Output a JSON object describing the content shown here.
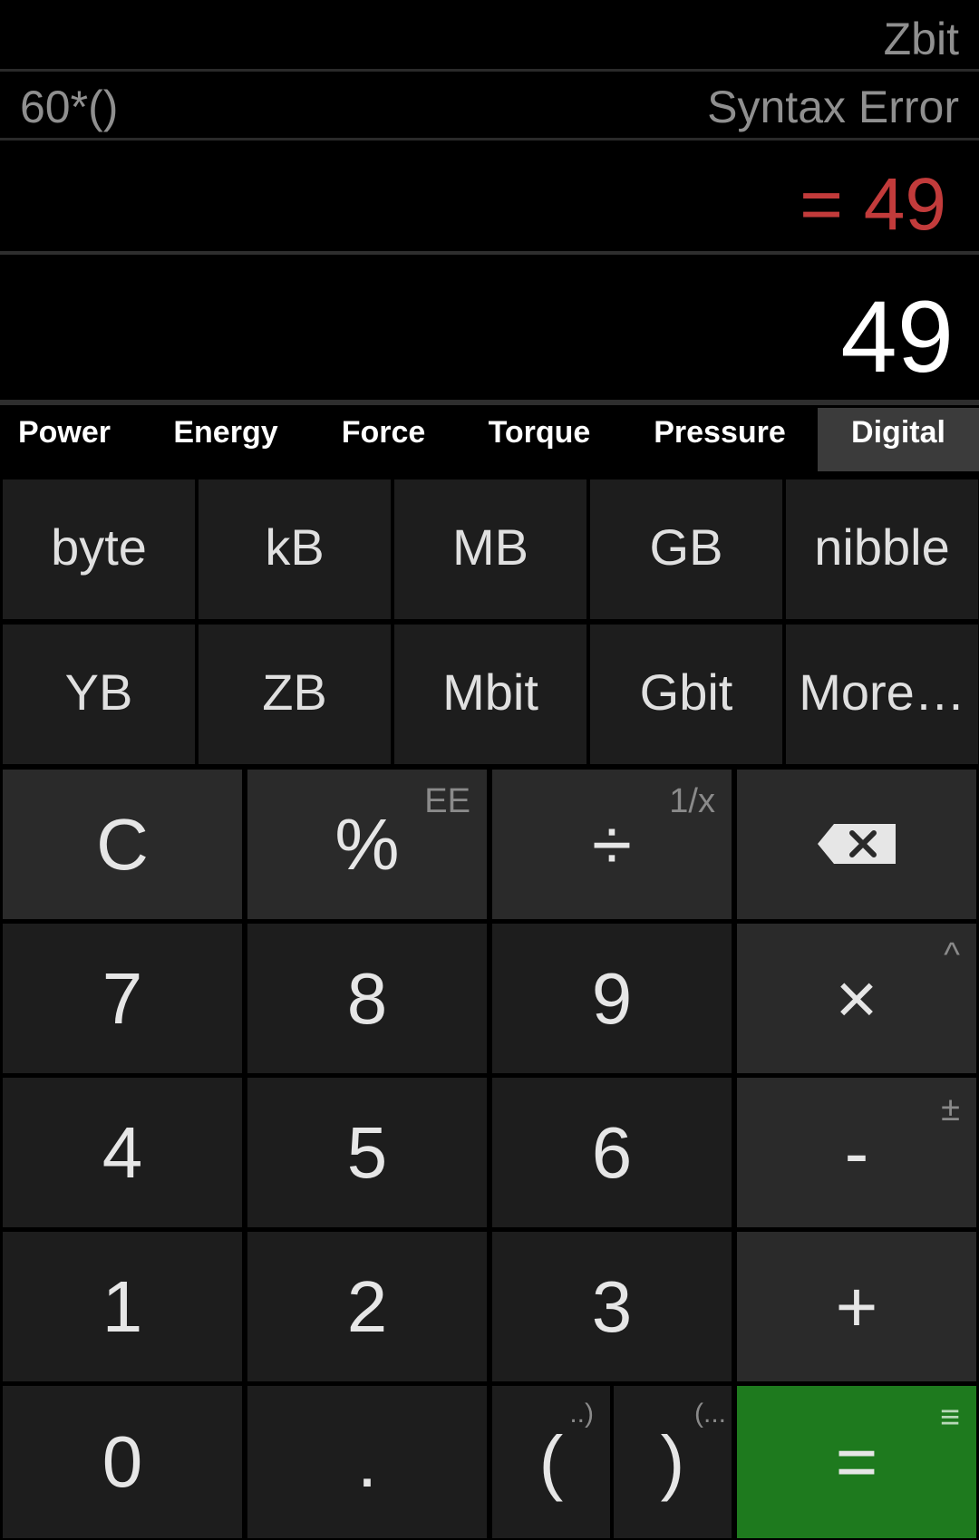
{
  "history": {
    "line1_right": "Zbit",
    "line2_left": "60*()",
    "line2_right": "Syntax Error"
  },
  "result": {
    "text": "= 49",
    "color": "#c23b3b"
  },
  "entry": {
    "text": "49"
  },
  "tabs": [
    "Power",
    "Energy",
    "Force",
    "Torque",
    "Pressure",
    "Digital"
  ],
  "active_tab": "Digital",
  "units": [
    {
      "label": "byte",
      "more": true
    },
    {
      "label": "kB",
      "more": true
    },
    {
      "label": "MB",
      "more": true
    },
    {
      "label": "GB",
      "more": true
    },
    {
      "label": "nibble",
      "more": true
    },
    {
      "label": "YB",
      "more": true
    },
    {
      "label": "ZB",
      "more": true
    },
    {
      "label": "Mbit",
      "more": true
    },
    {
      "label": "Gbit",
      "more": true
    },
    {
      "label": "More…",
      "more": false
    }
  ],
  "keys": {
    "clear": "C",
    "percent": "%",
    "percent_sub": "EE",
    "divide": "÷",
    "divide_sub": "1/x",
    "backspace_icon": "backspace-icon",
    "seven": "7",
    "eight": "8",
    "nine": "9",
    "multiply": "×",
    "multiply_sub": "^",
    "four": "4",
    "five": "5",
    "six": "6",
    "minus": "-",
    "minus_sub": "±",
    "one": "1",
    "two": "2",
    "three": "3",
    "plus": "+",
    "zero": "0",
    "dot": ".",
    "open_paren": "(",
    "open_paren_sub": "..)",
    "close_paren": ")",
    "close_paren_sub": "(...",
    "equals": "=",
    "equals_sub": "≡"
  },
  "colors": {
    "equals_bg": "#1e7a1e",
    "result": "#c23b3b"
  }
}
